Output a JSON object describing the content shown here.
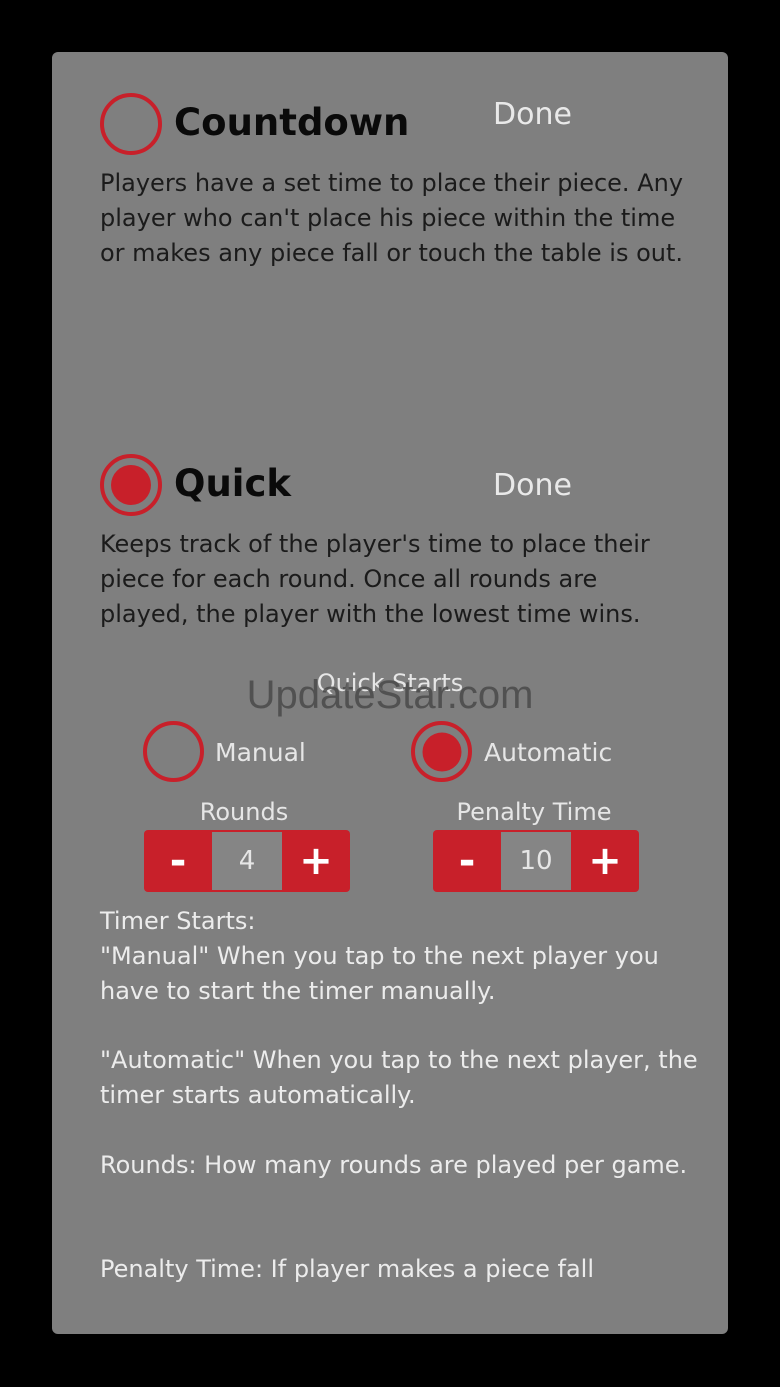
{
  "countdown": {
    "title": "Countdown",
    "done_label": "Done",
    "selected": false,
    "description": "Players have a set time to place their piece. Any player who can't place his piece within the time or makes any piece fall or touch the table is out."
  },
  "quick": {
    "title": "Quick",
    "done_label": "Done",
    "selected": true,
    "description": "Keeps track of the player's time to place their piece for each round. Once all rounds are played, the player with the lowest time wins.",
    "quick_starts_heading": "Quick Starts",
    "options": [
      {
        "label": "Manual",
        "selected": false
      },
      {
        "label": "Automatic",
        "selected": true
      }
    ],
    "rounds": {
      "label": "Rounds",
      "value": "4",
      "minus": "-",
      "plus": "+"
    },
    "penalty": {
      "label": "Penalty Time",
      "value": "10",
      "minus": "-",
      "plus": "+"
    },
    "help": {
      "timer_starts": "Timer Starts:",
      "manual": "\"Manual\" When you tap to the next player you have to start the timer manually.",
      "automatic": "\"Automatic\" When you tap to the next player, the timer starts automatically.",
      "rounds": "Rounds: How many rounds are played per game.",
      "penalty": "Penalty Time: If player makes a piece fall"
    }
  },
  "watermark": "UpdateStar.com",
  "colors": {
    "accent": "#c8202a",
    "panel": "#7f7f7f",
    "background": "#000000"
  }
}
